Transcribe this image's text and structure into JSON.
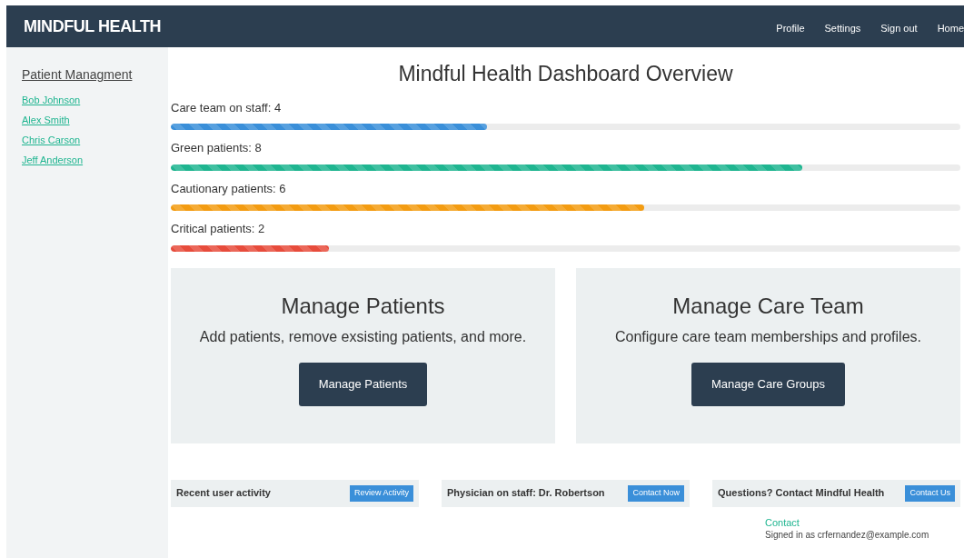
{
  "brand": "MINDFUL HEALTH",
  "nav": [
    "Profile",
    "Settings",
    "Sign out",
    "Home"
  ],
  "sidebar": {
    "title": "Patient Managment",
    "items": [
      "Bob Johnson",
      "Alex Smith",
      "Chris Carson",
      "Jeff Anderson"
    ]
  },
  "title": "Mindful Health Dashboard Overview",
  "stats": [
    {
      "label": "Care team on staff: 4",
      "level": 0.4,
      "color": "#3a8fd9"
    },
    {
      "label": "Green patients: 8",
      "level": 0.8,
      "color": "#1fb590"
    },
    {
      "label": "Cautionary patients: 6",
      "level": 0.6,
      "color": "#f39c12"
    },
    {
      "label": "Critical patients: 2",
      "level": 0.2,
      "color": "#e74c3c"
    }
  ],
  "cards": [
    {
      "title": "Manage Patients",
      "text": "Add patients, remove exsisting patients, and more.",
      "button": "Manage Patients"
    },
    {
      "title": "Manage Care Team",
      "text": "Configure care team memberships and profiles.",
      "button": "Manage Care Groups"
    }
  ],
  "strips": [
    {
      "label": "Recent user activity",
      "button": "Review Activity"
    },
    {
      "label": "Physician on staff: Dr. Robertson",
      "button": "Contact Now"
    },
    {
      "label": "Questions? Contact Mindful Health",
      "button": "Contact Us"
    }
  ],
  "footer": {
    "link": "Contact",
    "signed_in": "Signed in as crfernandez@example.com"
  }
}
